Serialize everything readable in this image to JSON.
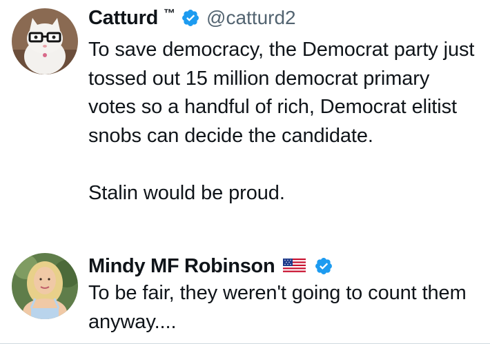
{
  "tweets": [
    {
      "display_name": "Catturd",
      "name_suffix": "™",
      "handle": "@catturd2",
      "verified": true,
      "text": "To save democracy, the Democrat party just tossed out 15 million democrat primary votes so a handful of rich, Democrat elitist snobs can decide the candidate.\n\nStalin would be proud."
    },
    {
      "display_name": "Mindy MF Robinson",
      "verified": true,
      "flag": "us-flag",
      "text": "To be fair, they weren't going to count them anyway...."
    }
  ],
  "colors": {
    "verified_blue": "#1d9bf0",
    "handle_gray": "#536471",
    "text": "#0f1419"
  },
  "icons": {
    "verified": "verified-badge-icon",
    "flag": "us-flag-icon"
  }
}
